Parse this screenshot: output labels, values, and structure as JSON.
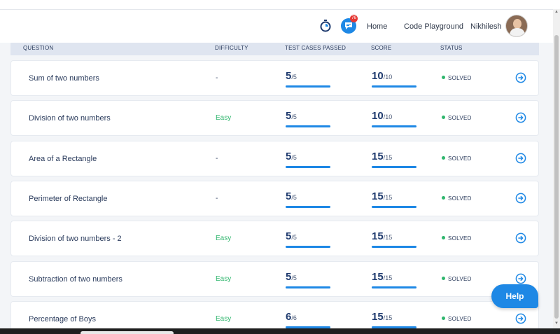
{
  "nav": {
    "home": "Home",
    "code_playground": "Code Playground",
    "user": "Nikhilesh",
    "notification_count": "76"
  },
  "table": {
    "headers": {
      "question": "QUESTION",
      "difficulty": "DIFFICULTY",
      "test_cases": "TEST CASES PASSED",
      "score": "SCORE",
      "status": "STATUS"
    },
    "rows": [
      {
        "question": "Sum of two numbers",
        "difficulty": "-",
        "tc_passed": "5",
        "tc_total": "/5",
        "score": "10",
        "score_total": "/10",
        "status": "SOLVED",
        "tc_progress": 1.0,
        "score_progress": 1.0
      },
      {
        "question": "Division of two numbers",
        "difficulty": "Easy",
        "tc_passed": "5",
        "tc_total": "/5",
        "score": "10",
        "score_total": "/10",
        "status": "SOLVED",
        "tc_progress": 1.0,
        "score_progress": 1.0
      },
      {
        "question": "Area of a Rectangle",
        "difficulty": "-",
        "tc_passed": "5",
        "tc_total": "/5",
        "score": "15",
        "score_total": "/15",
        "status": "SOLVED",
        "tc_progress": 1.0,
        "score_progress": 1.0
      },
      {
        "question": "Perimeter of Rectangle",
        "difficulty": "-",
        "tc_passed": "5",
        "tc_total": "/5",
        "score": "15",
        "score_total": "/15",
        "status": "SOLVED",
        "tc_progress": 1.0,
        "score_progress": 1.0
      },
      {
        "question": "Division of two numbers - 2",
        "difficulty": "Easy",
        "tc_passed": "5",
        "tc_total": "/5",
        "score": "15",
        "score_total": "/15",
        "status": "SOLVED",
        "tc_progress": 1.0,
        "score_progress": 1.0
      },
      {
        "question": "Subtraction of two numbers",
        "difficulty": "Easy",
        "tc_passed": "5",
        "tc_total": "/5",
        "score": "15",
        "score_total": "/15",
        "status": "SOLVED",
        "tc_progress": 1.0,
        "score_progress": 1.0
      },
      {
        "question": "Percentage of Boys",
        "difficulty": "Easy",
        "tc_passed": "6",
        "tc_total": "/6",
        "score": "15",
        "score_total": "/15",
        "status": "SOLVED",
        "tc_progress": 1.0,
        "score_progress": 1.0
      }
    ]
  },
  "help": {
    "label": "Help"
  },
  "colors": {
    "accent": "#1e88e5",
    "easy": "#2fb66d",
    "solved_dot": "#2fb66d",
    "badge": "#e53935"
  },
  "icons": {
    "timer": "stopwatch-icon",
    "chat": "chat-icon",
    "row_action": "arrow-right-circle-icon"
  }
}
